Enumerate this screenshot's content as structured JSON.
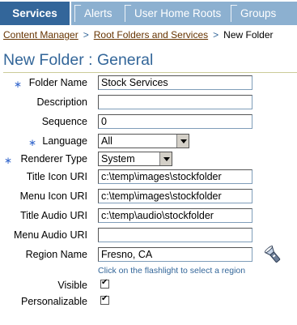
{
  "tabs": [
    {
      "label": "Services",
      "active": true
    },
    {
      "label": "Alerts",
      "active": false
    },
    {
      "label": "User Home Roots",
      "active": false
    },
    {
      "label": "Groups",
      "active": false
    }
  ],
  "breadcrumb": {
    "items": [
      "Content Manager",
      "Root Folders and Services"
    ],
    "separator": ">",
    "current": "New Folder"
  },
  "page": {
    "title": "New Folder : General"
  },
  "form": {
    "required_marker": "∗",
    "folder_name": {
      "label": "Folder Name",
      "value": "Stock Services",
      "required": true
    },
    "description": {
      "label": "Description",
      "value": ""
    },
    "sequence": {
      "label": "Sequence",
      "value": "0"
    },
    "language": {
      "label": "Language",
      "value": "All",
      "required": true
    },
    "renderer_type": {
      "label": "Renderer Type",
      "value": "System",
      "required": true
    },
    "title_icon_uri": {
      "label": "Title Icon URI",
      "value": "c:\\temp\\images\\stockfolder"
    },
    "menu_icon_uri": {
      "label": "Menu Icon URI",
      "value": "c:\\temp\\images\\stockfolder"
    },
    "title_audio_uri": {
      "label": "Title Audio URI",
      "value": "c:\\temp\\audio\\stockfolder"
    },
    "menu_audio_uri": {
      "label": "Menu Audio URI",
      "value": ""
    },
    "region_name": {
      "label": "Region Name",
      "value": "Fresno, CA",
      "hint": "Click on the flashlight to select a region"
    },
    "visible": {
      "label": "Visible",
      "checked": true
    },
    "personalizable": {
      "label": "Personalizable",
      "checked": true
    }
  },
  "colors": {
    "tab_active": "#33669a",
    "tab_inactive": "#8cb0d0",
    "title": "#336699",
    "link": "#663300"
  }
}
